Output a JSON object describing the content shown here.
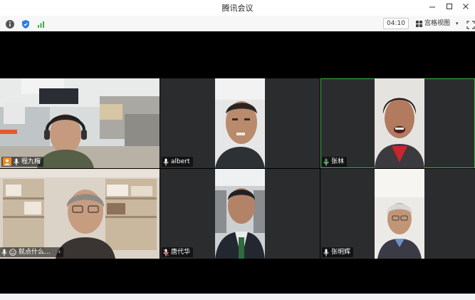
{
  "window": {
    "title": "腾讯会议",
    "controls": [
      "minimize-icon",
      "maximize-icon",
      "close-icon"
    ]
  },
  "toolbar": {
    "icons": [
      "info-icon",
      "shield-icon",
      "signal-icon"
    ],
    "timer": "04:10",
    "view_label": "宫格视图",
    "fullscreen_icon": "fullscreen-icon"
  },
  "participants": [
    {
      "name": "程九梅",
      "host": true,
      "mic": "on",
      "speaking": false
    },
    {
      "name": "albert",
      "host": false,
      "mic": "on",
      "speaking": false
    },
    {
      "name": "张林",
      "host": false,
      "mic": "on",
      "speaking": true
    },
    {
      "name": "就点什么...",
      "host": false,
      "mic": "on",
      "speaking": false
    },
    {
      "name": "唐代华",
      "host": false,
      "mic": "muted",
      "speaking": false
    },
    {
      "name": "张明辉",
      "host": false,
      "mic": "on",
      "speaking": false
    }
  ],
  "colors": {
    "speaking_border": "#3fae48",
    "host_badge": "#f08a24",
    "muted_mic": "#e23b3b",
    "active_mic": "#3fae48"
  }
}
